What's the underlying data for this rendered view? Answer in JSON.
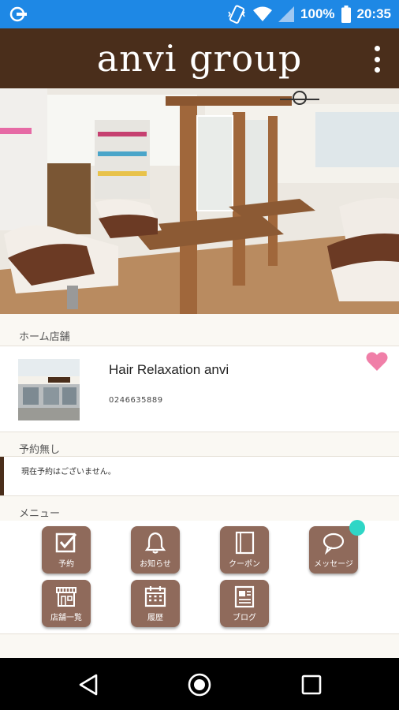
{
  "status_bar": {
    "battery": "100%",
    "time": "20:35",
    "color": "#1e88e5"
  },
  "app_bar": {
    "title": "anvi  group",
    "color": "#4a2e1b",
    "overflow_icon": "more-vert-icon"
  },
  "hero": {
    "description_icon": "salon-interior-photo"
  },
  "home_shop": {
    "section_title": "ホーム店舗",
    "name": "Hair Relaxation anvi",
    "phone": "0246635889",
    "favorite_icon": "heart-icon",
    "favorite_color": "#f07fa8"
  },
  "reservation": {
    "section_title": "予約無し",
    "message": "現在予約はございません。"
  },
  "menu": {
    "section_title": "メニュー",
    "button_color": "#8f6a5b",
    "items": [
      {
        "label": "予約",
        "icon": "checkbox-icon"
      },
      {
        "label": "お知らせ",
        "icon": "bell-icon"
      },
      {
        "label": "クーポン",
        "icon": "coupon-book-icon"
      },
      {
        "label": "メッセージ",
        "icon": "chat-bubble-icon",
        "badge": true
      },
      {
        "label": "店舗一覧",
        "icon": "storefront-icon"
      },
      {
        "label": "履歴",
        "icon": "calendar-icon"
      },
      {
        "label": "ブログ",
        "icon": "blog-document-icon"
      }
    ]
  },
  "nav_bar": {
    "back_icon": "back-triangle-icon",
    "home_icon": "home-circle-icon",
    "recents_icon": "recents-square-icon"
  }
}
